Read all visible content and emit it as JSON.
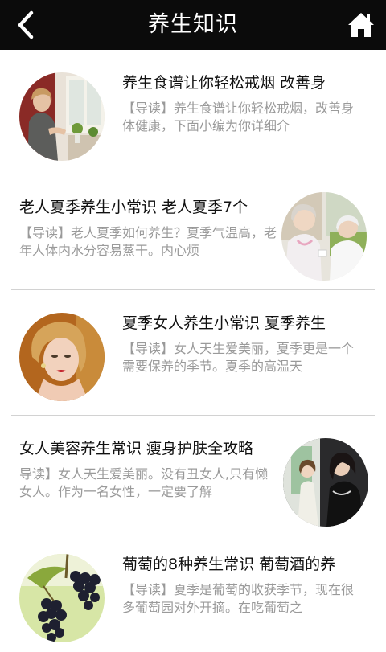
{
  "header": {
    "title": "养生知识",
    "back_icon": "chevron-left-icon",
    "home_icon": "home-icon"
  },
  "articles": [
    {
      "title": "养生食谱让你轻松戒烟 改善身",
      "summary": "【导读】养生食谱让你轻松戒烟，改善身体健康，下面小编为你详细介"
    },
    {
      "title": "老人夏季养生小常识 老人夏季7个",
      "summary": "【导读】老人夏季如何养生？夏季气温高，老年人体内水分容易蒸干。内心烦"
    },
    {
      "title": "夏季女人养生小常识 夏季养生",
      "summary": "【导读】女人天生爱美丽，夏季更是一个需要保养的季节。夏季的高温天"
    },
    {
      "title": "女人美容养生常识 瘦身护肤全攻略",
      "summary": "导读】女人天生爱美丽。没有丑女人,只有懒女人。作为一名女性，一定要了解"
    },
    {
      "title": "葡萄的8种养生常识 葡萄酒的养",
      "summary": "【导读】夏季是葡萄的收获季节，现在很多葡萄园对外开摘。在吃葡萄之"
    }
  ],
  "colors": {
    "header_bg": "#0b0b0b",
    "title_text": "#111111",
    "summary_text": "#9a9a9a",
    "divider": "#d2d2d2"
  }
}
